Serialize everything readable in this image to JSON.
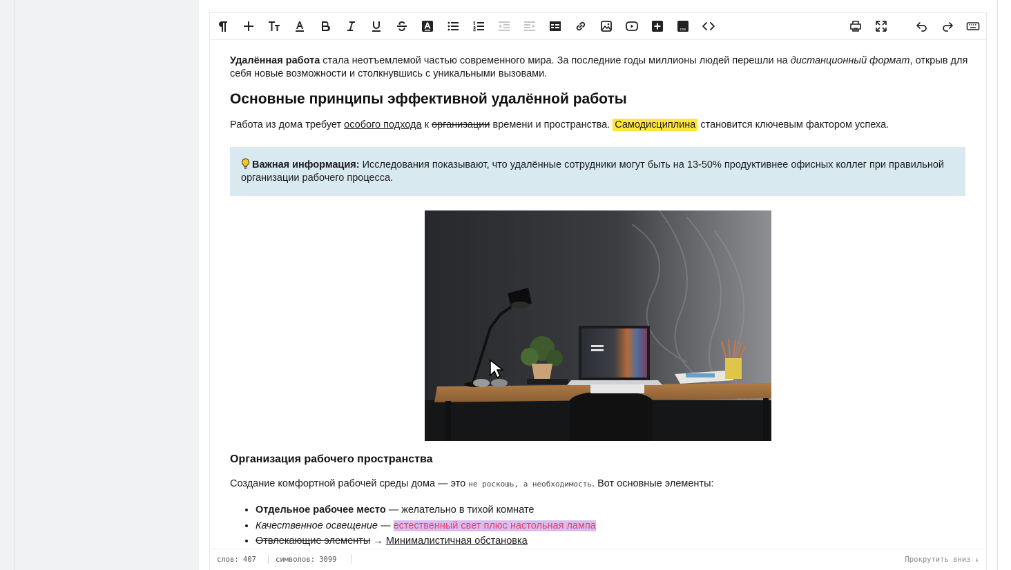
{
  "toolbar": {
    "buttons": [
      {
        "name": "paragraph-icon",
        "title": "Paragraph"
      },
      {
        "name": "plus-icon",
        "title": "Insert"
      },
      {
        "name": "font-size-icon",
        "title": "Font size"
      },
      {
        "name": "font-color-icon",
        "title": "Font color"
      },
      {
        "name": "bold-icon",
        "title": "Bold"
      },
      {
        "name": "italic-icon",
        "title": "Italic"
      },
      {
        "name": "underline-icon",
        "title": "Underline"
      },
      {
        "name": "strikethrough-icon",
        "title": "Strikethrough"
      },
      {
        "name": "highlight-icon",
        "title": "Highlight"
      },
      {
        "name": "bullet-list-icon",
        "title": "Bulleted list"
      },
      {
        "name": "numbered-list-icon",
        "title": "Numbered list"
      },
      {
        "name": "outdent-icon",
        "title": "Outdent"
      },
      {
        "name": "indent-icon",
        "title": "Indent"
      },
      {
        "name": "table-icon",
        "title": "Table"
      },
      {
        "name": "link-icon",
        "title": "Link"
      },
      {
        "name": "image-icon",
        "title": "Image"
      },
      {
        "name": "video-icon",
        "title": "Video"
      },
      {
        "name": "add-block-icon",
        "title": "Add block"
      },
      {
        "name": "css-icon",
        "title": "CSS"
      },
      {
        "name": "code-icon",
        "title": "Source"
      },
      {
        "name": "print-icon",
        "title": "Print"
      },
      {
        "name": "fullscreen-icon",
        "title": "Fullscreen"
      },
      {
        "name": "undo-icon",
        "title": "Undo"
      },
      {
        "name": "redo-icon",
        "title": "Redo"
      },
      {
        "name": "keyboard-icon",
        "title": "Keyboard"
      }
    ]
  },
  "content": {
    "intro": {
      "bold": "Удалённая работа",
      "text1": " стала неотъемлемой частью современного мира. За последние годы миллионы людей перешли на ",
      "italic": "дистанционный формат",
      "text2": ", открыв для себя новые возможности и столкнувшись с уникальными вызовами."
    },
    "heading": "Основные принципы эффективной удалённой работы",
    "para2": {
      "t1": "Работа из дома требует ",
      "underline": "особого подхода",
      "t2": " к ",
      "strike": "организации",
      "t3": " времени и пространства. ",
      "highlight": "Самодисциплина",
      "t4": " становится ключевым фактором успеха."
    },
    "info": {
      "icon": "lightbulb-icon",
      "label": "Важная информация:",
      "text": " Исследования показывают, что удалённые сотрудники могут быть на 13-50% продуктивнее офисных коллег при правильной организации рабочего процесса."
    },
    "image": {
      "name": "desk-photo"
    },
    "subheading": "Организация рабочего пространства",
    "para3": {
      "t1": "Создание комфортной рабочей среды дома — это ",
      "code": "не роскошь, а необходимость",
      "t2": ". Вот основные элементы:"
    },
    "bullets": [
      {
        "bold": "Отдельное рабочее место",
        "rest": " — желательно в тихой комнате"
      },
      {
        "italic": "Качественное освещение",
        "dash": " — ",
        "highlight": "естественный свет плюс настольная лампа"
      },
      {
        "strike": "Отвлекающие элементы",
        "arrow": " → ",
        "underline": "Минималистичная обстановка"
      }
    ]
  },
  "status": {
    "words": "слов: 407",
    "chars": "символов: 3099",
    "scroll_down": "Прокрутить вниз ↓"
  },
  "colors": {
    "highlight": "#ffe63a",
    "info_bg": "#d9e9f0",
    "pink_text": "#ec3f6a",
    "pink_bg": "#d9bdf0"
  }
}
